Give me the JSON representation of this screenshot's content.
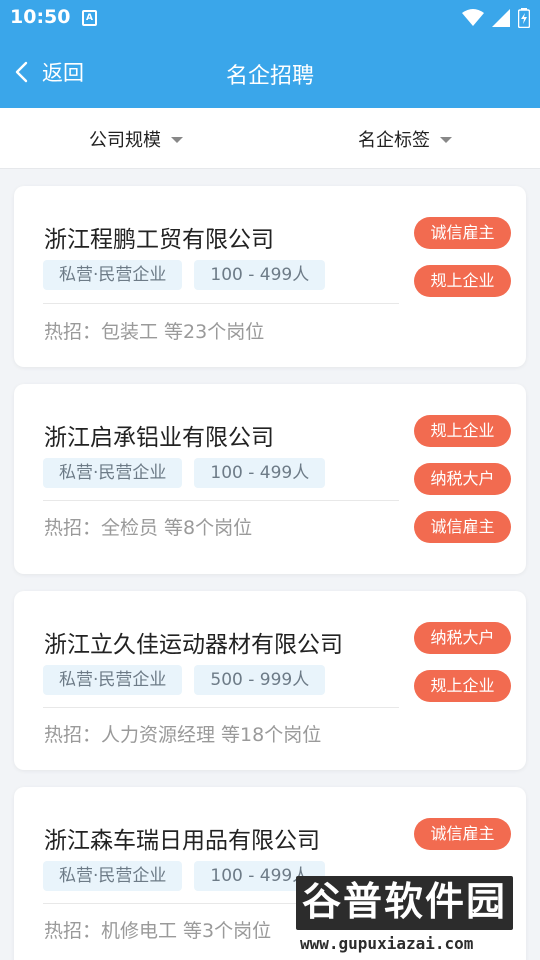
{
  "status": {
    "time": "10:50",
    "sim_label": "A"
  },
  "header": {
    "back_label": "返回",
    "title": "名企招聘"
  },
  "filters": {
    "size_label": "公司规模",
    "tag_label": "名企标签"
  },
  "companies": [
    {
      "name": "浙江程鹏工贸有限公司",
      "type": "私营·民营企业",
      "size": "100 - 499人",
      "hot": "热招：包装工  等23个岗位",
      "badges": [
        "诚信雇主",
        "规上企业"
      ]
    },
    {
      "name": "浙江启承铝业有限公司",
      "type": "私营·民营企业",
      "size": "100 - 499人",
      "hot": "热招：全检员 等8个岗位",
      "badges": [
        "规上企业",
        "纳税大户",
        "诚信雇主"
      ]
    },
    {
      "name": "浙江立久佳运动器材有限公司",
      "type": "私营·民营企业",
      "size": "500 - 999人",
      "hot": "热招：人力资源经理 等18个岗位",
      "badges": [
        "纳税大户",
        "规上企业"
      ]
    },
    {
      "name": "浙江森车瑞日用品有限公司",
      "type": "私营·民营企业",
      "size": "100 - 499人",
      "hot": "热招：机修电工 等3个岗位",
      "badges": [
        "诚信雇主"
      ]
    }
  ],
  "watermark": {
    "brand": "谷普软件园",
    "url": "www.gupuxiazai.com"
  },
  "colors": {
    "primary": "#3aa6ea",
    "badge": "#f26b50",
    "chip_bg": "#e9f4fb"
  }
}
